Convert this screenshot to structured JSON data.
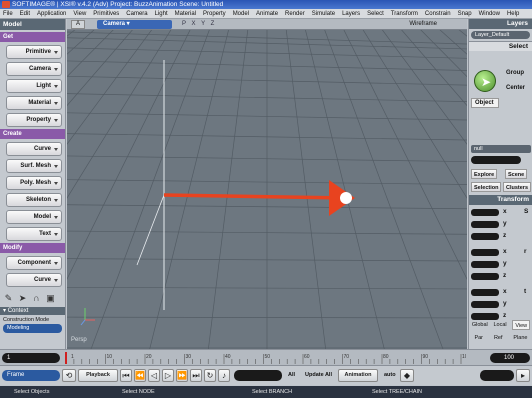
{
  "app": {
    "title": "SOFTIMAGE® | XSI® v.4.2 (Adv) Project: BuzzAnimation    Scene: Untitled"
  },
  "menu": [
    "File",
    "Edit",
    "Application",
    "View",
    "Primitives",
    "Camera",
    "Light",
    "Material",
    "Property",
    "Model",
    "Animate",
    "Render",
    "Simulate",
    "Layers",
    "Select",
    "Transform",
    "Constrain",
    "Snap",
    "Window",
    "Help"
  ],
  "left_panel": {
    "header": "Model",
    "sections": [
      {
        "title": "Get",
        "buttons": [
          "Primitive",
          "Camera",
          "Light",
          "Material",
          "Property"
        ]
      },
      {
        "title": "Create",
        "buttons": [
          "Curve",
          "Surf. Mesh",
          "Poly. Mesh",
          "Skeleton",
          "Model",
          "Text"
        ]
      },
      {
        "title": "Modify",
        "buttons": [
          "Component",
          "Curve"
        ]
      }
    ],
    "context_label": "Context",
    "construction_mode_label": "Construction Mode",
    "construction_mode_value": "Modeling"
  },
  "viewport": {
    "number": "A",
    "camera_label": "Camera",
    "tools": "P  X Y Z",
    "display_mode": "Wireframe",
    "corner_label": "Persp"
  },
  "right_panel": {
    "layers_title": "Layers",
    "layer_field": "Layer_Default",
    "select_title": "Select",
    "group_label": "Group",
    "center_label": "Center",
    "object_tab": "Object",
    "edit_field": "null",
    "explore_label": "Explore",
    "scene_label": "Scene",
    "selection_label": "Selection",
    "clusters_label": "Clusters",
    "transform_title": "Transform",
    "axes": [
      [
        "x",
        "S"
      ],
      [
        "y",
        ""
      ],
      [
        "z",
        ""
      ],
      [
        "x",
        "r"
      ],
      [
        "y",
        ""
      ],
      [
        "z",
        ""
      ],
      [
        "x",
        "t"
      ],
      [
        "y",
        ""
      ],
      [
        "z",
        ""
      ]
    ],
    "ref_modes": [
      "Global",
      "Local",
      "View"
    ],
    "ref_modes2": [
      "Par",
      "Ref",
      "Plane"
    ],
    "active_mode": "View"
  },
  "timeline": {
    "start": "1",
    "end": "100",
    "ticks": [
      "1",
      "10",
      "20",
      "30",
      "40",
      "50",
      "60",
      "70",
      "80",
      "90",
      "100"
    ]
  },
  "playbar": {
    "unit": "Frame",
    "playback_label": "Playback",
    "all_label": "All",
    "update_label": "Update All",
    "animation_label": "Animation",
    "auto_label": "auto"
  },
  "status": {
    "left": "Select Objects",
    "node": "Select NODE",
    "branch": "Select BRANCH",
    "tree": "Select TREE/CHAIN"
  },
  "colors": {
    "arrow": "#e8431f",
    "titlebar": "#2a55b5",
    "grid_bg": "#6d7780"
  }
}
